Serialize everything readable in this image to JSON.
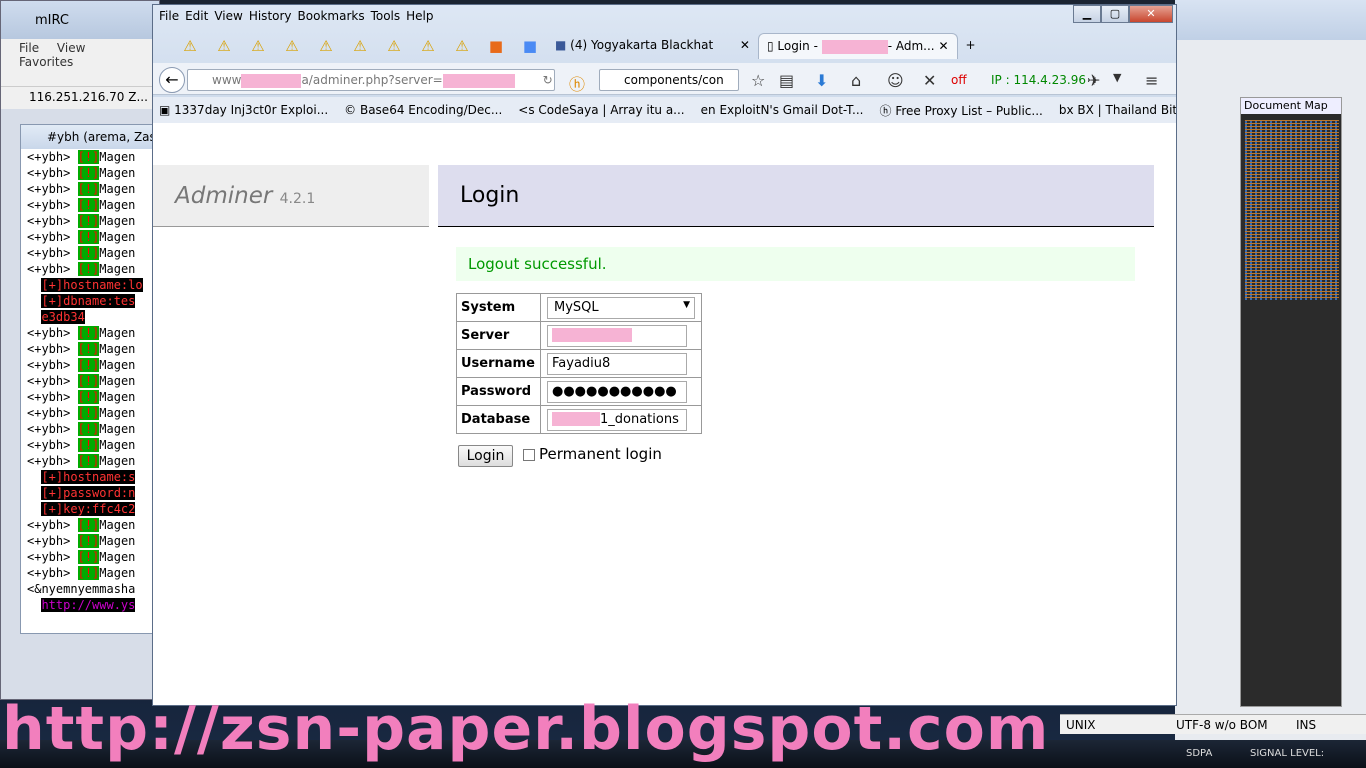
{
  "desktop": {
    "taskbar": {
      "item1": "SDPA",
      "item2": "SIGNAL LEVEL:"
    }
  },
  "mirc": {
    "title": "mIRC",
    "menu": [
      "File",
      "View",
      "Favorites"
    ],
    "address": "116.251.216.70 Z...",
    "channel_title": "#ybh (arema, Zasie",
    "lines": [
      {
        "nick": "<+ybh>",
        "flag": "[!]",
        "text": "Magen"
      },
      {
        "nick": "<+ybh>",
        "flag": "[!]",
        "text": "Magen"
      },
      {
        "nick": "<+ybh>",
        "flag": "[!]",
        "text": "Magen"
      },
      {
        "nick": "<+ybh>",
        "flag": "[!]",
        "text": "Magen"
      },
      {
        "nick": "<+ybh>",
        "flag": "[!]",
        "text": "Magen"
      },
      {
        "nick": "<+ybh>",
        "flag": "[!]",
        "text": "Magen"
      },
      {
        "nick": "<+ybh>",
        "flag": "[!]",
        "text": "Magen"
      },
      {
        "nick": "<+ybh>",
        "flag": "[!]",
        "text": "Magen"
      }
    ],
    "red1": "[+]hostname:lo",
    "red2": "[+]dbname:tes",
    "red3": "e3db34",
    "lines2": [
      {
        "nick": "<+ybh>",
        "flag": "[!]",
        "text": "Magen"
      },
      {
        "nick": "<+ybh>",
        "flag": "[!]",
        "text": "Magen"
      },
      {
        "nick": "<+ybh>",
        "flag": "[!]",
        "text": "Magen"
      },
      {
        "nick": "<+ybh>",
        "flag": "[!]",
        "text": "Magen"
      },
      {
        "nick": "<+ybh>",
        "flag": "[!]",
        "text": "Magen"
      },
      {
        "nick": "<+ybh>",
        "flag": "[!]",
        "text": "Magen"
      },
      {
        "nick": "<+ybh>",
        "flag": "[!]",
        "text": "Magen"
      },
      {
        "nick": "<+ybh>",
        "flag": "[!]",
        "text": "Magen"
      },
      {
        "nick": "<+ybh>",
        "flag": "[!]",
        "text": "Magen"
      }
    ],
    "red4": "[+]hostname:s",
    "red5": "[+]password:n",
    "red6": "[+]key:ffc4c2",
    "lines3": [
      {
        "nick": "<+ybh>",
        "flag": "[!]",
        "text": "Magen"
      },
      {
        "nick": "<+ybh>",
        "flag": "[!]",
        "text": "Magen"
      },
      {
        "nick": "<+ybh>",
        "flag": "[!]",
        "text": "Magen"
      },
      {
        "nick": "<+ybh>",
        "flag": "[!]",
        "text": "Magen"
      }
    ],
    "last_nick": "<&nyemnyemmasha",
    "link": "http://www.ys"
  },
  "notepadpp": {
    "docmap_title": "Document Map",
    "status": {
      "eol": "UNIX",
      "encoding": "UTF-8 w/o BOM",
      "mode": "INS"
    }
  },
  "firefox": {
    "menu": [
      "File",
      "Edit",
      "View",
      "History",
      "Bookmarks",
      "Tools",
      "Help"
    ],
    "tabs": [
      {
        "label": "(4) Yogyakarta Blackhat"
      },
      {
        "label": "Login - ",
        "suffix": "- Adm..."
      }
    ],
    "url_prefix": "www",
    "url_mid": "a/adminer.php?server=",
    "search_value": "components/con",
    "ip_status": "off",
    "ip_text": "IP : 114.4.23.96",
    "bookmarks": [
      "1337day Inj3ct0r Exploi...",
      "Base64 Encoding/Dec...",
      "CodeSaya | Array itu a...",
      "ExploitN's Gmail Dot-T...",
      "Free Proxy List – Public...",
      "BX | Thailand Bitcoin E..."
    ]
  },
  "adminer": {
    "name": "Adminer",
    "version": "4.2.1",
    "heading": "Login",
    "message": "Logout successful.",
    "labels": {
      "system": "System",
      "server": "Server",
      "username": "Username",
      "password": "Password",
      "database": "Database"
    },
    "values": {
      "system": "MySQL",
      "username": "Fayadiu8",
      "password": "●●●●●●●●●●●",
      "database_suffix": "1_donations"
    },
    "login_button": "Login",
    "permanent_login": "Permanent login"
  },
  "watermark": "http://zsn-paper.blogspot.com"
}
